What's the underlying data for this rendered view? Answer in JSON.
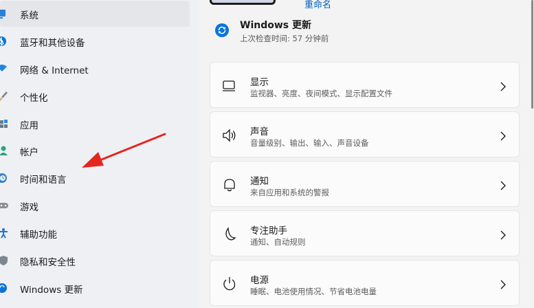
{
  "sidebar": {
    "items": [
      {
        "label": "系统",
        "icon": "system-icon"
      },
      {
        "label": "蓝牙和其他设备",
        "icon": "bluetooth-icon"
      },
      {
        "label": "网络 & Internet",
        "icon": "wifi-icon"
      },
      {
        "label": "个性化",
        "icon": "brush-icon"
      },
      {
        "label": "应用",
        "icon": "apps-icon"
      },
      {
        "label": "帐户",
        "icon": "account-icon"
      },
      {
        "label": "时间和语言",
        "icon": "clock-globe-icon"
      },
      {
        "label": "游戏",
        "icon": "gamepad-icon"
      },
      {
        "label": "辅助功能",
        "icon": "accessibility-icon"
      },
      {
        "label": "隐私和安全性",
        "icon": "shield-icon"
      },
      {
        "label": "Windows 更新",
        "icon": "windows-update-icon"
      }
    ]
  },
  "header": {
    "rename_label": "重命名"
  },
  "windows_update": {
    "title": "Windows 更新",
    "subtitle": "上次检查时间: 57 分钟前"
  },
  "cards": [
    {
      "title": "显示",
      "subtitle": "监视器、亮度、夜间模式、显示配置文件",
      "icon": "display-icon"
    },
    {
      "title": "声音",
      "subtitle": "音量级别、输出、输入、声音设备",
      "icon": "speaker-icon"
    },
    {
      "title": "通知",
      "subtitle": "来自应用和系统的警报",
      "icon": "bell-icon"
    },
    {
      "title": "专注助手",
      "subtitle": "通知、自动规则",
      "icon": "moon-icon"
    },
    {
      "title": "电源",
      "subtitle": "睡眠、电池使用情况、节省电池电量",
      "icon": "power-icon"
    }
  ],
  "colors": {
    "accent": "#0067c0",
    "annotation_arrow": "#e5251f"
  }
}
